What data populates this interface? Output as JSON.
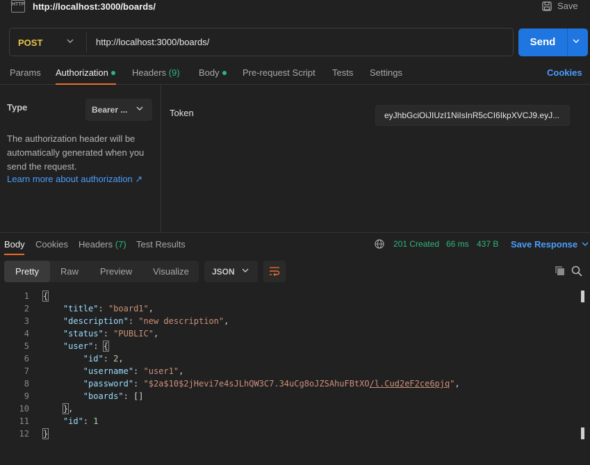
{
  "header": {
    "icon_text": "HTTP",
    "title": "http://localhost:3000/boards/",
    "save_label": "Save"
  },
  "request": {
    "method": "POST",
    "url": "http://localhost:3000/boards/",
    "send_label": "Send"
  },
  "tabs": {
    "params": "Params",
    "authorization": "Authorization",
    "headers": "Headers",
    "headers_count": "(9)",
    "body": "Body",
    "prerequest": "Pre-request Script",
    "tests": "Tests",
    "settings": "Settings",
    "cookies": "Cookies"
  },
  "auth": {
    "type_label": "Type",
    "type_value": "Bearer ...",
    "description": "The authorization header will be automatically generated when you send the request.",
    "learn_more": "Learn more about authorization ↗",
    "token_label": "Token",
    "token_value": "eyJhbGciOiJIUzI1NiIsInR5cCI6IkpXVCJ9.eyJ..."
  },
  "response": {
    "tabs": {
      "body": "Body",
      "cookies": "Cookies",
      "headers": "Headers",
      "headers_count": "(7)",
      "test_results": "Test Results"
    },
    "status": "201 Created",
    "time": "66 ms",
    "size": "437 B",
    "save_response": "Save Response",
    "view_tabs": [
      "Pretty",
      "Raw",
      "Preview",
      "Visualize"
    ],
    "format": "JSON",
    "line_numbers": [
      "1",
      "2",
      "3",
      "4",
      "5",
      "6",
      "7",
      "8",
      "9",
      "10",
      "11",
      "12"
    ],
    "body": {
      "title": "board1",
      "description": "new description",
      "status": "PUBLIC",
      "user": {
        "id": "2",
        "username": "user1",
        "password_a": "$2a$10$2jHevi7e4sJLhQW3C7.34uCg8oJZSAhuFBtXO",
        "password_b": "/l.Cud2eF2ce6pjq",
        "boards": "[]"
      },
      "id": "1"
    }
  },
  "colors": {
    "accent": "#e96d2a",
    "send": "#1f76e0",
    "link": "#4a9eff",
    "success": "#2eb67d",
    "method": "#e8c347"
  }
}
